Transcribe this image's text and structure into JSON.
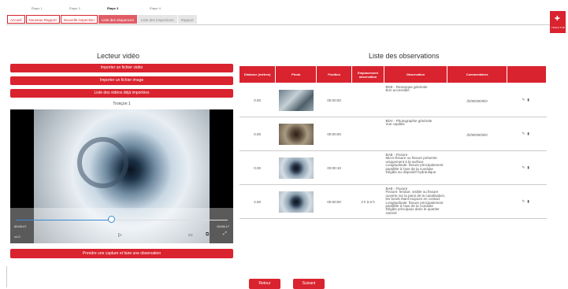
{
  "steps": [
    "Étape 1",
    "Étape 2",
    "Étape 3",
    "Étape 4"
  ],
  "tabs": [
    {
      "label": "Accueil",
      "style": "red"
    },
    {
      "label": "Nouveau Rapport",
      "style": "red"
    },
    {
      "label": "Nouvelle inspection",
      "style": "red"
    },
    {
      "label": "Liste des séquences",
      "style": "active"
    },
    {
      "label": "Liste des inspections",
      "style": "grey"
    },
    {
      "label": "Rapport",
      "style": "grey"
    }
  ],
  "logo": {
    "text": "TRAFF-TUB"
  },
  "left": {
    "title": "Lecteur vidéo",
    "buttons": [
      "Importer un fichier vidéo",
      "Importer un fichier image",
      "Liste des vidéos déjà importées"
    ],
    "frame_label": "Tronçon 1",
    "video": {
      "time_left": "00:00:47",
      "time_right": "00:05:17",
      "speed": "x1.0",
      "progress": 0.45
    },
    "capture_button": "Prendre une capture et faire une observation"
  },
  "right": {
    "title": "Liste des observations",
    "headers": [
      "Distance (mètres)",
      "Photo",
      "Position",
      "Emplacement observation",
      "Observation",
      "Commentaires",
      ""
    ],
    "rows": [
      {
        "distance": "0.00",
        "photo": "photo-1",
        "position": "00:00:00",
        "emplacement": "",
        "observation": "BDE - Remarque générale\nBon accessible",
        "comment": "jjjjjgjjgjgjjgjjg"
      },
      {
        "distance": "0.00",
        "photo": "photo-2",
        "position": "00:00:00",
        "emplacement": "",
        "observation": "BDV - Photographie générale\nVue capillée",
        "comment": "jjjjjgjjgjgjjgjjg"
      },
      {
        "distance": "0.00",
        "photo": "photo-3",
        "position": "00:00:10",
        "emplacement": "",
        "observation": "BAB - Fissure\nMicro-fissure ou fissure présente uniquement à la surface\nLongitudinale: fissure principalement parallèle à l'axe de la conduite\nDégâts au dispositif hydraulique",
        "comment": ""
      },
      {
        "distance": "2.00",
        "photo": "photo-4",
        "position": "00:00:00",
        "emplacement": "3 h à 6 h",
        "observation": "BAB - Fissure\nFissure: fendue, visible ou fissure ouverte sur la paroi de la canalisation, les bords étant toujours en contact\nLongitudinale: fissure principalement parallèle à l'axe de la conduite\nDégâts principaux dans le quartier sinistré",
        "comment": ""
      }
    ]
  },
  "footer": {
    "back": "Retour",
    "next": "Suivant"
  }
}
